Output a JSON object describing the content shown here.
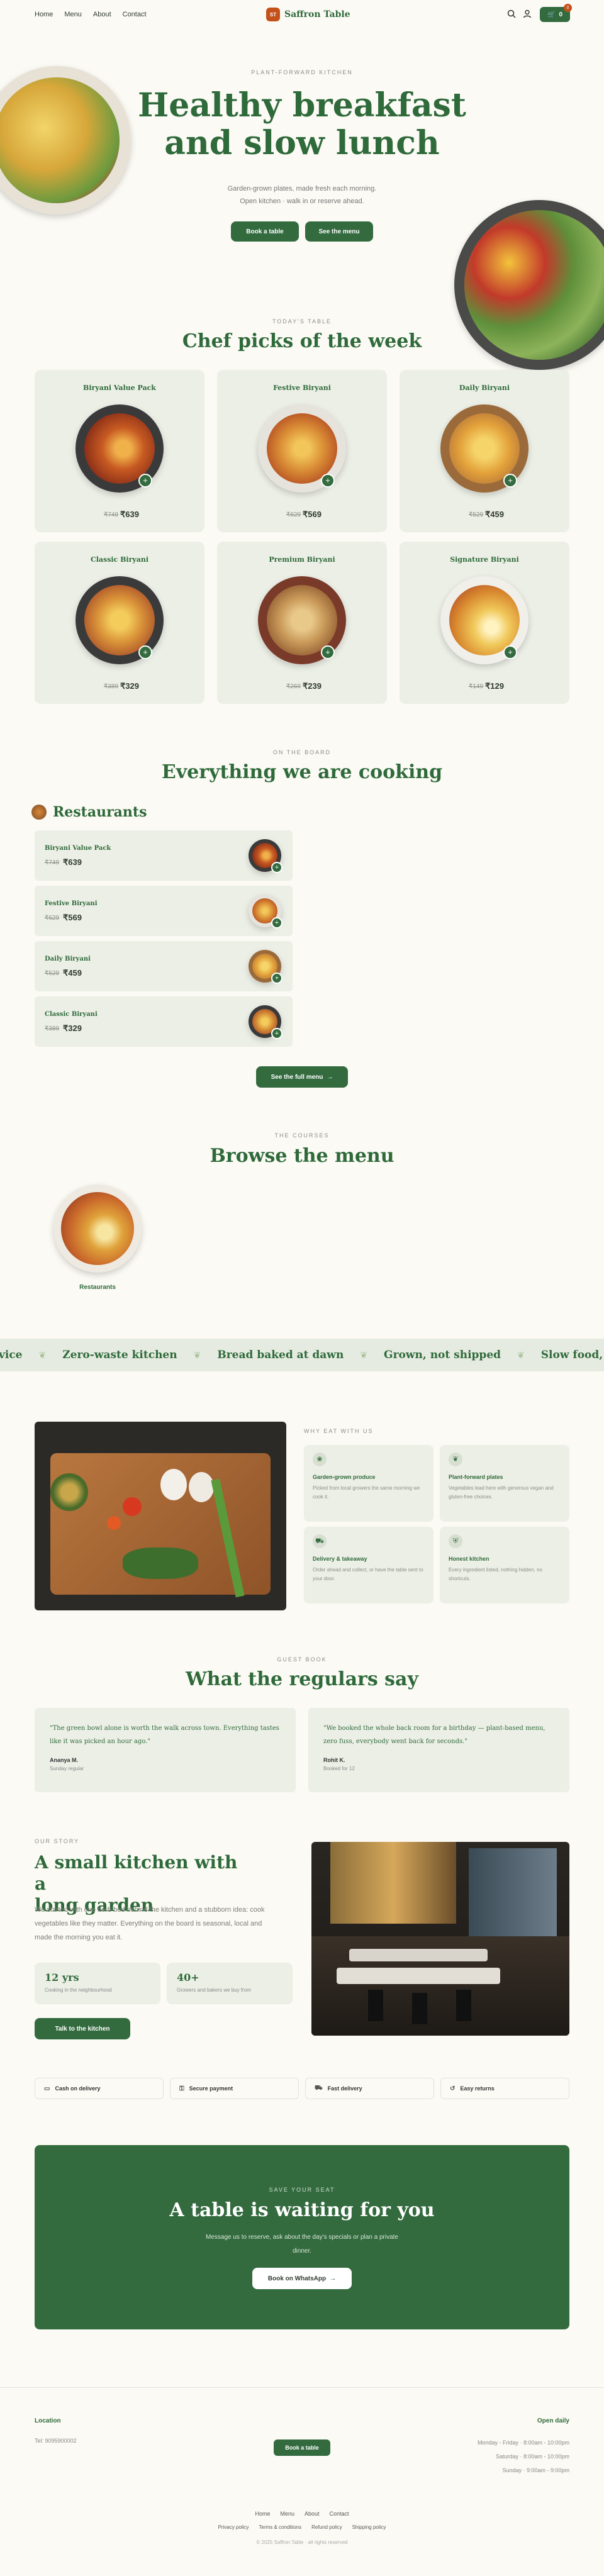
{
  "nav": {
    "links": [
      "Home",
      "Menu",
      "About",
      "Contact"
    ],
    "brand": "Saffron Table",
    "brand_mark": "ST",
    "cart_count": "0",
    "cart_badge": "0"
  },
  "hero": {
    "eyebrow": "PLANT-FORWARD KITCHEN",
    "title_line1": "Healthy breakfast",
    "title_line2": "and slow lunch",
    "sub1": "Garden-grown plates, made fresh each morning.",
    "sub2": "Open kitchen · walk in or reserve ahead.",
    "btn_book": "Book a table",
    "btn_menu": "See the menu"
  },
  "picks": {
    "eyebrow": "TODAY'S TABLE",
    "title": "Chef picks of the week",
    "items": [
      {
        "name": "Biryani Value Pack",
        "old": "₹749",
        "price": "₹639"
      },
      {
        "name": "Festive Biryani",
        "old": "₹629",
        "price": "₹569"
      },
      {
        "name": "Daily Biryani",
        "old": "₹529",
        "price": "₹459"
      },
      {
        "name": "Classic Biryani",
        "old": "₹389",
        "price": "₹329"
      },
      {
        "name": "Premium Biryani",
        "old": "₹269",
        "price": "₹239"
      },
      {
        "name": "Signature Biryani",
        "old": "₹149",
        "price": "₹129"
      }
    ]
  },
  "board": {
    "eyebrow": "ON THE BOARD",
    "title": "Everything we are cooking",
    "category": "Restaurants",
    "items": [
      {
        "name": "Biryani Value Pack",
        "old": "₹749",
        "price": "₹639"
      },
      {
        "name": "Festive Biryani",
        "old": "₹629",
        "price": "₹569"
      },
      {
        "name": "Daily Biryani",
        "old": "₹529",
        "price": "₹459"
      },
      {
        "name": "Classic Biryani",
        "old": "₹389",
        "price": "₹329"
      }
    ],
    "btn": "See the full menu"
  },
  "courses": {
    "eyebrow": "THE COURSES",
    "title": "Browse the menu",
    "item": "Restaurants"
  },
  "marquee": {
    "items": [
      "vice",
      "Zero-waste kitchen",
      "Bread baked at dawn",
      "Grown, not shipped",
      "Slow food, fast service"
    ]
  },
  "why": {
    "eyebrow": "WHY EAT WITH US",
    "features": [
      {
        "title": "Garden-grown produce",
        "text": "Picked from local growers the same morning we cook it."
      },
      {
        "title": "Plant-forward plates",
        "text": "Vegetables lead here with generous vegan and gluten-free choices."
      },
      {
        "title": "Delivery & takeaway",
        "text": "Order ahead and collect, or have the table sent to your door."
      },
      {
        "title": "Honest kitchen",
        "text": "Every ingredient listed, nothing hidden, no shortcuts."
      }
    ]
  },
  "guest": {
    "eyebrow": "GUEST BOOK",
    "title": "What the regulars say",
    "reviews": [
      {
        "quote": "\"The green bowl alone is worth the walk across town. Everything tastes like it was picked an hour ago.\"",
        "name": "Ananya M.",
        "role": "Sunday regular"
      },
      {
        "quote": "\"We booked the whole back room for a birthday — plant-based menu, zero fuss, everybody went back for seconds.\"",
        "name": "Rohit K.",
        "role": "Booked for 12"
      }
    ]
  },
  "story": {
    "eyebrow": "OUR STORY",
    "title_line1": "A small kitchen with a",
    "title_line2": "long garden",
    "text": "We started with one herb bed behind the kitchen and a stubborn idea: cook vegetables like they matter. Everything on the board is seasonal, local and made the morning you eat it.",
    "stat1_value": "12 yrs",
    "stat1_label": "Cooking in the neighbourhood",
    "stat2_value": "40+",
    "stat2_label": "Growers and bakers we buy from",
    "btn": "Talk to the kitchen"
  },
  "perks": [
    "Cash on delivery",
    "Secure payment",
    "Fast delivery",
    "Easy returns"
  ],
  "cta": {
    "eyebrow": "SAVE YOUR SEAT",
    "title": "A table is waiting for you",
    "text1": "Message us to reserve, ask about the day's specials or plan a private",
    "text2": "dinner.",
    "btn": "Book on WhatsApp"
  },
  "footer": {
    "location_title": "Location",
    "phone": "Tel: 9095900002",
    "btn": "Book a table",
    "hours_title": "Open daily",
    "hours": [
      "Monday - Friday · 8:00am - 10:00pm",
      "Saturday · 8:00am - 10:00pm",
      "Sunday · 9:00am - 9:00pm"
    ],
    "links": [
      "Home",
      "Menu",
      "About",
      "Contact"
    ],
    "legal": [
      "Privacy policy",
      "Terms & conditions",
      "Refund policy",
      "Shipping policy"
    ],
    "copyright": "© 2025 Saffron Table · all rights reserved"
  },
  "colors": {
    "brand": "#336b3f",
    "accent": "#c4501a",
    "background": "#fbfaf4",
    "card": "#ecefe6"
  }
}
